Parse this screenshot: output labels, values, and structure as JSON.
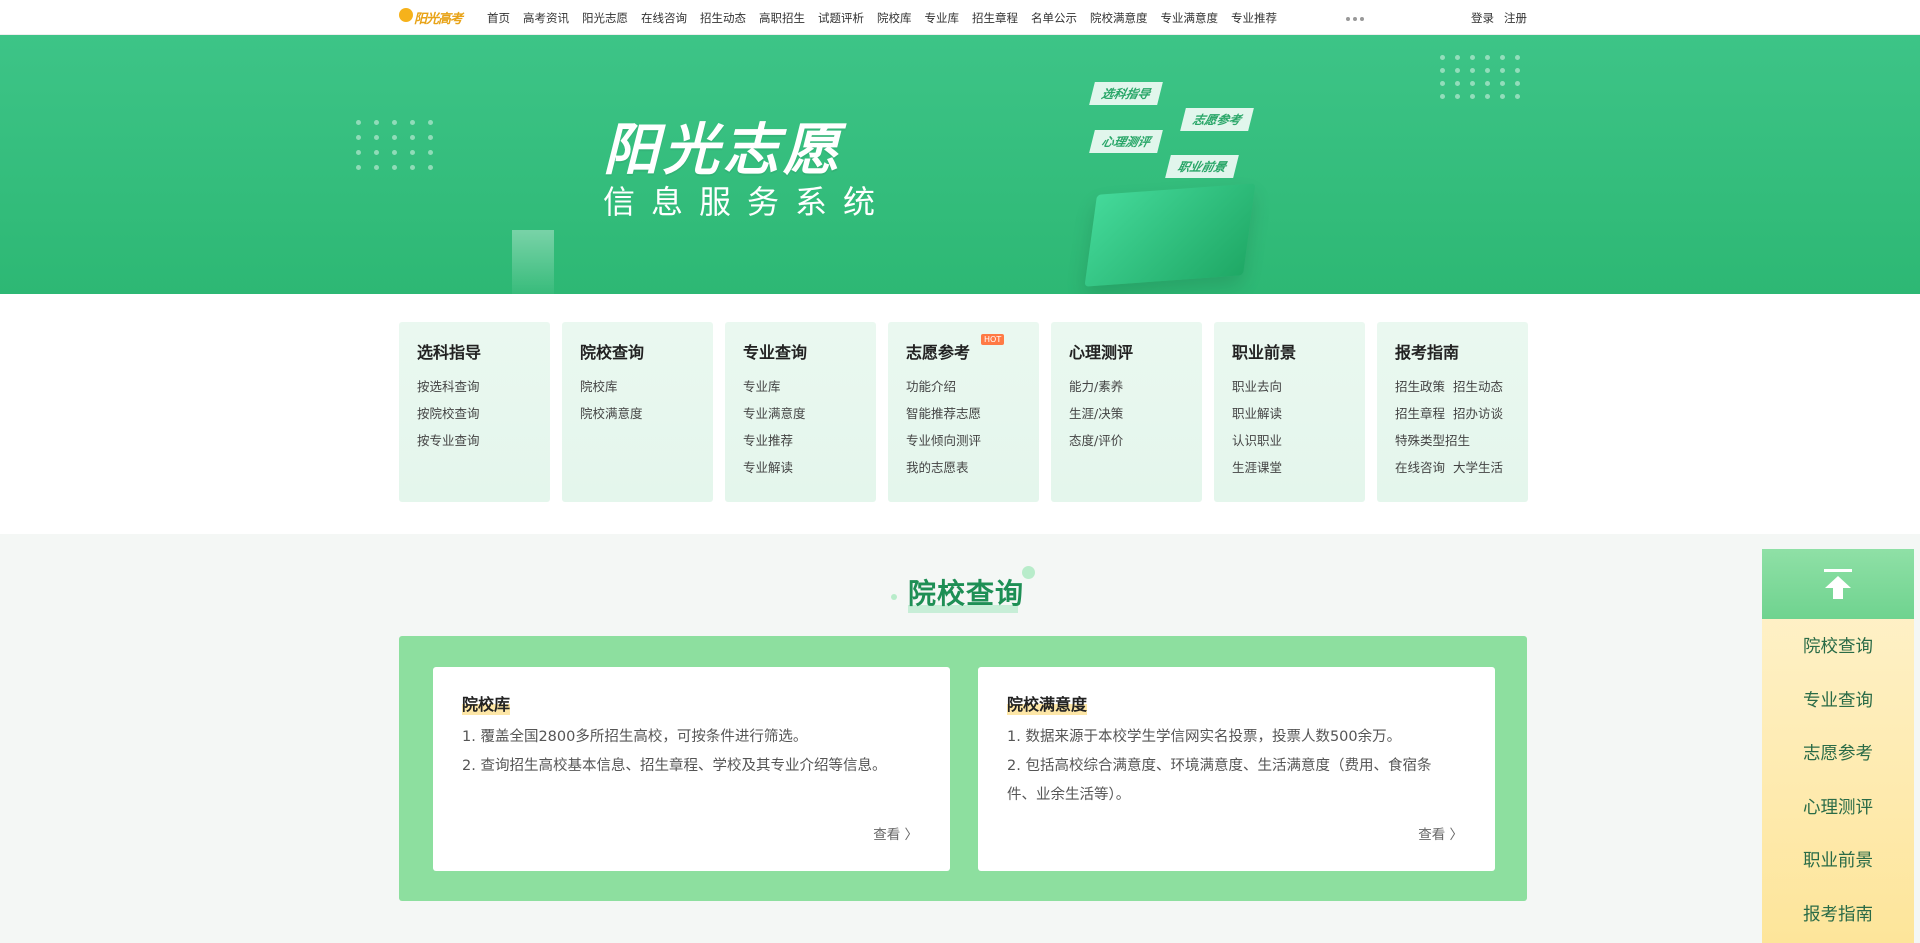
{
  "header": {
    "logo_text": "阳光高考",
    "nav": [
      "首页",
      "高考资讯",
      "阳光志愿",
      "在线咨询",
      "招生动态",
      "高职招生",
      "试题评析",
      "院校库",
      "专业库",
      "招生章程",
      "名单公示",
      "院校满意度",
      "专业满意度",
      "专业推荐"
    ],
    "login": "登录",
    "register": "注册"
  },
  "banner": {
    "title": "阳光志愿",
    "subtitle": "信息服务系统",
    "tags": [
      "选科指导",
      "志愿参考",
      "心理测评",
      "职业前景"
    ]
  },
  "quick_cards": [
    {
      "title": "选科指导",
      "links": [
        "按选科查询",
        "按院校查询",
        "按专业查询"
      ]
    },
    {
      "title": "院校查询",
      "links": [
        "院校库",
        "院校满意度"
      ]
    },
    {
      "title": "专业查询",
      "links": [
        "专业库",
        "专业满意度",
        "专业推荐",
        "专业解读"
      ]
    },
    {
      "title": "志愿参考",
      "badge": "HOT",
      "links": [
        "功能介绍",
        "智能推荐志愿",
        "专业倾向测评",
        "我的志愿表"
      ]
    },
    {
      "title": "心理测评",
      "links": [
        "能力/素养",
        "生涯/决策",
        "态度/评价"
      ]
    },
    {
      "title": "职业前景",
      "links": [
        "职业去向",
        "职业解读",
        "认识职业",
        "生涯课堂"
      ]
    },
    {
      "title": "报考指南",
      "rows": [
        [
          "招生政策",
          "招生动态"
        ],
        [
          "招生章程",
          "招办访谈"
        ],
        [
          "特殊类型招生"
        ],
        [
          "在线咨询",
          "大学生活"
        ]
      ]
    }
  ],
  "section": {
    "title": "院校查询",
    "cards": [
      {
        "title": "院校库",
        "lines": [
          "1. 覆盖全国2800多所招生高校，可按条件进行筛选。",
          "2. 查询招生高校基本信息、招生章程、学校及其专业介绍等信息。"
        ],
        "more": "查看 〉"
      },
      {
        "title": "院校满意度",
        "lines": [
          "1. 数据来源于本校学生学信网实名投票，投票人数500余万。",
          "2. 包括高校综合满意度、环境满意度、生活满意度（费用、食宿条",
          "件、业余生活等）。"
        ],
        "more": "查看 〉"
      }
    ]
  },
  "side_nav": {
    "items": [
      "院校查询",
      "专业查询",
      "志愿参考",
      "心理测评",
      "职业前景",
      "报考指南"
    ]
  },
  "colors": {
    "brand_green": "#2db874",
    "panel_green": "#8ddf9f",
    "section_title": "#1e8f55",
    "hot_badge": "#ff7a45"
  }
}
